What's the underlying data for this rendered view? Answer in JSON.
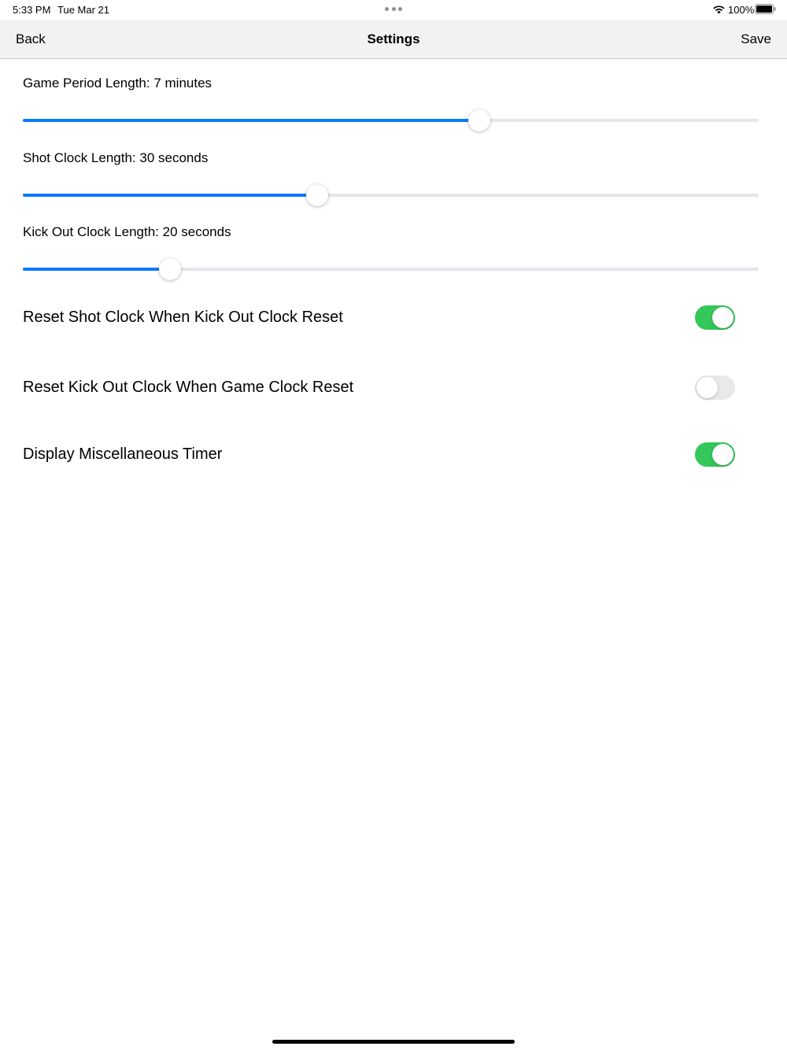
{
  "status_bar": {
    "time": "5:33 PM",
    "date": "Tue Mar 21",
    "battery": "100%",
    "icons": [
      "more-dots-icon",
      "wifi-icon",
      "battery-icon"
    ]
  },
  "nav": {
    "back_label": "Back",
    "title": "Settings",
    "save_label": "Save"
  },
  "sliders": [
    {
      "label": "Game Period Length: 7 minutes",
      "value_fraction": 0.62
    },
    {
      "label": "Shot Clock Length: 30 seconds",
      "value_fraction": 0.4
    },
    {
      "label": "Kick Out Clock Length: 20 seconds",
      "value_fraction": 0.2
    }
  ],
  "toggles": [
    {
      "label": "Reset Shot Clock When Kick Out Clock Reset",
      "on": true
    },
    {
      "label": "Reset Kick Out Clock When Game Clock Reset",
      "on": false
    },
    {
      "label": "Display Miscellaneous Timer",
      "on": true
    }
  ],
  "colors": {
    "accent": "#0a7aff",
    "toggle_on": "#34c759",
    "toggle_off": "#e9e9eb",
    "track": "#e5e5ea",
    "nav_background": "#f2f2f2"
  }
}
